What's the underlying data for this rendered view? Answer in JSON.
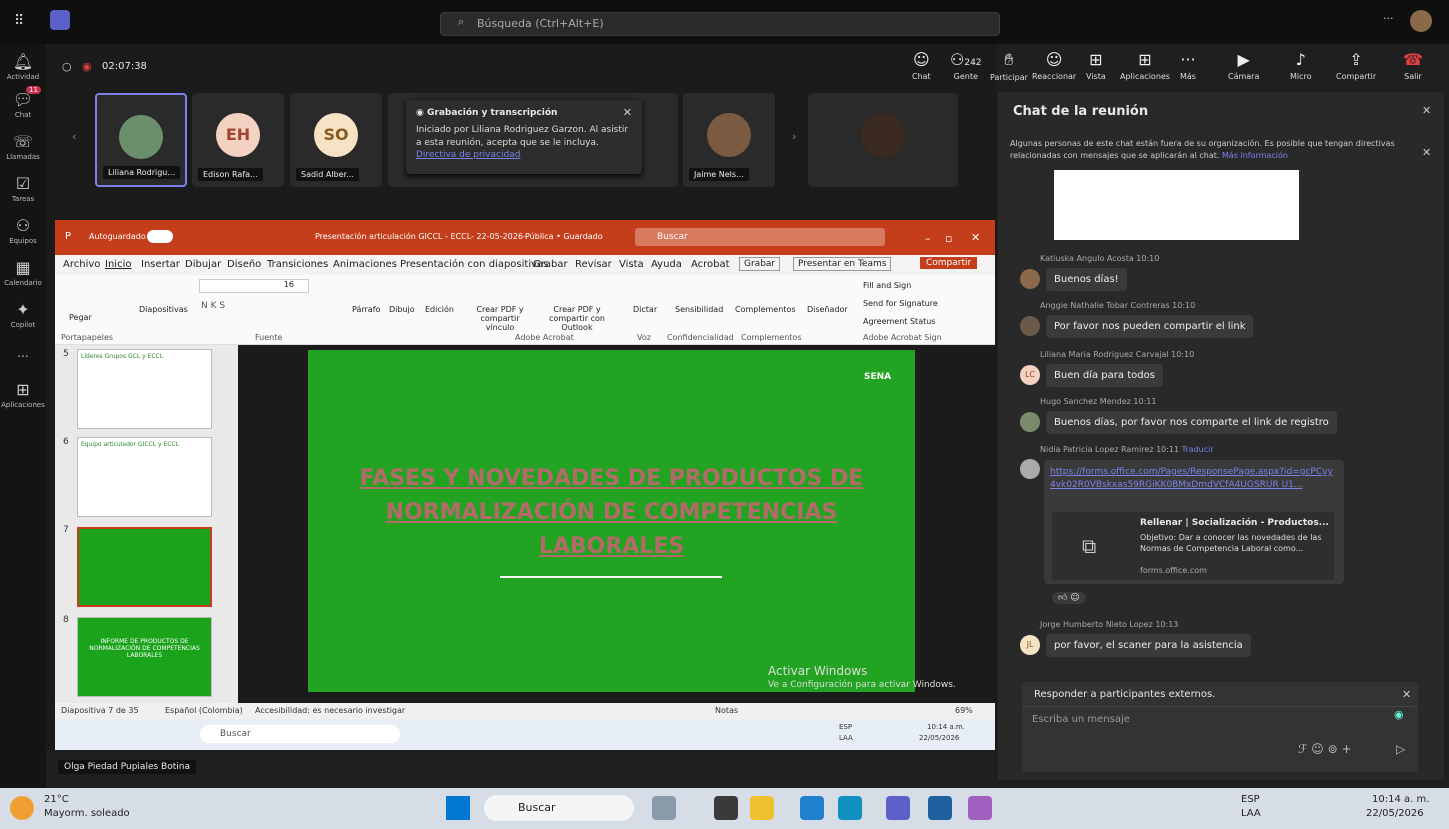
{
  "teams": {
    "search_placeholder": "Búsqueda (Ctrl+Alt+E)",
    "timer": "02:07:38"
  },
  "rail": [
    {
      "label": "Actividad",
      "icon": "bell-icon"
    },
    {
      "label": "Chat",
      "icon": "chat-icon",
      "badge": "11"
    },
    {
      "label": "Llamadas",
      "icon": "phone-icon"
    },
    {
      "label": "Tareas",
      "icon": "tasks-icon"
    },
    {
      "label": "Equipos",
      "icon": "teams-icon"
    },
    {
      "label": "Calendario",
      "icon": "calendar-icon"
    },
    {
      "label": "Copilot",
      "icon": "copilot-icon"
    },
    {
      "label": "...",
      "icon": "more-icon"
    },
    {
      "label": "Aplicaciones",
      "icon": "apps-icon"
    }
  ],
  "controls": [
    {
      "label": "Chat"
    },
    {
      "label": "Gente",
      "count": "242"
    },
    {
      "label": "Participar"
    },
    {
      "label": "Reaccionar"
    },
    {
      "label": "Vista"
    },
    {
      "label": "Aplicaciones"
    },
    {
      "label": "Más"
    },
    {
      "label": "Cámara"
    },
    {
      "label": "Micro"
    },
    {
      "label": "Compartir"
    },
    {
      "label": "Salir"
    }
  ],
  "participants": [
    "Liliana Rodrigu...",
    "Edison Rafa...",
    "Sadid Alber...",
    "Jaime Nels..."
  ],
  "avatars": {
    "eh": "EH",
    "so": "SO"
  },
  "recording": {
    "title": "Grabación y transcripción",
    "body": "Iniciado por Liliana Rodriguez Garzon. Al asistir a esta reunión, acepta que se le incluya.",
    "link": "Directiva de privacidad"
  },
  "ppt": {
    "autosave": "Autoguardado",
    "doc_title": "Presentación articulación GICCL - ECCL- 22-05-2026-",
    "visibility": "Pública • Guardado",
    "search": "Buscar",
    "menu": [
      "Archivo",
      "Inicio",
      "Insertar",
      "Dibujar",
      "Diseño",
      "Transiciones",
      "Animaciones",
      "Presentación con diapositivas",
      "Grabar",
      "Revisar",
      "Vista",
      "Ayuda",
      "Acrobat"
    ],
    "grabar": "Grabar",
    "present_teams": "Presentar en Teams",
    "share": "Compartir",
    "ribbon": [
      "Pegar",
      "Diapositivas",
      "Párrafo",
      "Dibujo",
      "Edición",
      "Crear PDF y compartir vínculo",
      "Crear PDF y compartir con Outlook",
      "Dictar",
      "Sensibilidad",
      "Complementos",
      "Diseñador"
    ],
    "acrobat_sign": [
      "Fill and Sign",
      "Send for Signature",
      "Agreement Status"
    ],
    "groups": [
      "Portapapeles",
      "Fuente",
      "Adobe Acrobat",
      "Voz",
      "Confidencialidad",
      "Complementos",
      "Adobe Acrobat Sign"
    ],
    "font_size": "16",
    "thumbs": [
      {
        "num": "5",
        "title": "Líderes Grupos GCL y ECCL"
      },
      {
        "num": "6",
        "title": "Equipo articulador GICCL y ECCL"
      },
      {
        "num": "7",
        "title": ""
      },
      {
        "num": "8",
        "title": "INFORME DE PRODUCTOS DE NORMALIZACIÓN DE COMPETENCIAS LABORALES"
      }
    ],
    "slide_title": "FASES Y NOVEDADES DE PRODUCTOS DE NORMALIZACIÓN DE COMPETENCIAS LABORALES",
    "logo": "SENA",
    "watermark1": "Activar Windows",
    "watermark2": "Ve a Configuración para activar Windows.",
    "status_slide": "Diapositiva 7 de 35",
    "status_lang": "Español (Colombia)",
    "status_access": "Accesibilidad: es necesario investigar",
    "notes": "Notas",
    "zoom": "69%",
    "inner_search": "Buscar",
    "inner_lang": "ESP",
    "inner_lang2": "LAA",
    "inner_time": "10:14 a.m.",
    "inner_date": "22/05/2026"
  },
  "speaker": "Olga Piedad Pupiales Botina",
  "chat": {
    "title": "Chat de la reunión",
    "notice": "Algunas personas de este chat están fuera de su organización. Es posible que tengan directivas relacionadas con mensajes que se aplicarán al chat.",
    "notice_link": "Más información",
    "messages": [
      {
        "who": "Katiuska Angulo Acosta  10:10",
        "text": "Buenos días!"
      },
      {
        "who": "Anggie Nathalie Tobar Contreras  10:10",
        "text": "Por favor nos pueden compartir el link"
      },
      {
        "who": "Liliana Maria Rodriguez Carvajal  10:10",
        "initials": "LC",
        "text": "Buen día para todos"
      },
      {
        "who": "Hugo Sanchez Mendez  10:11",
        "text": "Buenos días, por favor nos comparte el link de registro"
      },
      {
        "who": "Nidia Patricia Lopez Ramirez  10:11",
        "translate": "Traducir",
        "link": "https://forms.office.com/Pages/ResponsePage.aspx?id=gcPCyy4vk02R0VBskxas59RGiKK0BMxDmdVCfA4UGSRUR U1...",
        "card_title": "Rellenar | Socialización - Productos...",
        "card_desc": "Objetivo: Dar a conocer las novedades de las Normas de Competencia Laboral como...",
        "card_domain": "forms.office.com"
      },
      {
        "who": "Jorge Humberto Nieto Lopez  10:13",
        "initials": "JL",
        "text": "por favor, el scaner para la asistencia"
      }
    ],
    "reply_header": "Responder a participantes externos.",
    "input_placeholder": "Escriba un mensaje"
  },
  "taskbar": {
    "temp": "21°C",
    "weather": "Mayorm. soleado",
    "search": "Buscar",
    "lang1": "ESP",
    "lang2": "LAA",
    "time": "10:14 a. m.",
    "date": "22/05/2026"
  },
  "colors": {
    "ppt_red": "#c43e1c",
    "slide_green": "#22a322",
    "teams_purple": "#7b83eb",
    "slide_title": "#b56a6a"
  }
}
